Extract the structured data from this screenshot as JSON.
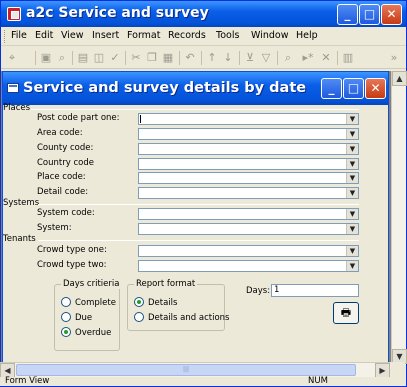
{
  "app": {
    "title": "a2c Service and survey",
    "window_buttons": {
      "minimize": "_",
      "maximize": "□",
      "close": "✕"
    }
  },
  "menu": [
    {
      "label": "File",
      "accel": "F"
    },
    {
      "label": "Edit",
      "accel": "E"
    },
    {
      "label": "View",
      "accel": "V"
    },
    {
      "label": "Insert",
      "accel": "I"
    },
    {
      "label": "Format",
      "accel": "o"
    },
    {
      "label": "Records",
      "accel": "R"
    },
    {
      "label": "Tools",
      "accel": "T"
    },
    {
      "label": "Window",
      "accel": "W"
    },
    {
      "label": "Help",
      "accel": "H"
    }
  ],
  "toolbar_icons": [
    "design-view-icon",
    "save-icon",
    "print-icon",
    "print-preview-icon",
    "spelling-icon",
    "cut-icon",
    "copy-icon",
    "paste-icon",
    "undo-icon",
    "sort-ascending-icon",
    "sort-descending-icon",
    "filter-by-selection-icon",
    "filter-by-form-icon",
    "find-icon",
    "new-record-icon",
    "database-window-icon"
  ],
  "form": {
    "title": "Service and survey details by date",
    "sections": {
      "places": "Places",
      "systems": "Systems",
      "tenants": "Tenants"
    },
    "fields": {
      "post_code": {
        "label": "Post code part one:",
        "value": ""
      },
      "area_code": {
        "label": "Area code:",
        "value": ""
      },
      "county_code": {
        "label": "County code:",
        "value": ""
      },
      "country_code": {
        "label": "Country code",
        "value": ""
      },
      "place_code": {
        "label": "Place code:",
        "value": ""
      },
      "detail_code": {
        "label": "Detail code:",
        "value": ""
      },
      "system_code": {
        "label": "System code:",
        "value": ""
      },
      "system": {
        "label": "System:",
        "value": ""
      },
      "crowd_type_one": {
        "label": "Crowd type one:",
        "value": ""
      },
      "crowd_type_two": {
        "label": "Crowd type two:",
        "value": ""
      }
    },
    "days_criteria": {
      "title": "Days critieria",
      "options": [
        "Complete",
        "Due",
        "Overdue"
      ],
      "selected": "Overdue"
    },
    "report_format": {
      "title": "Report format",
      "options": [
        "Details",
        "Details and actions"
      ],
      "selected": "Details"
    },
    "days": {
      "label": "Days:",
      "value": "1"
    },
    "dropdown_arrow": "▼",
    "print_button": "🖶"
  },
  "status": {
    "left": "Form View",
    "num": "NUM"
  }
}
